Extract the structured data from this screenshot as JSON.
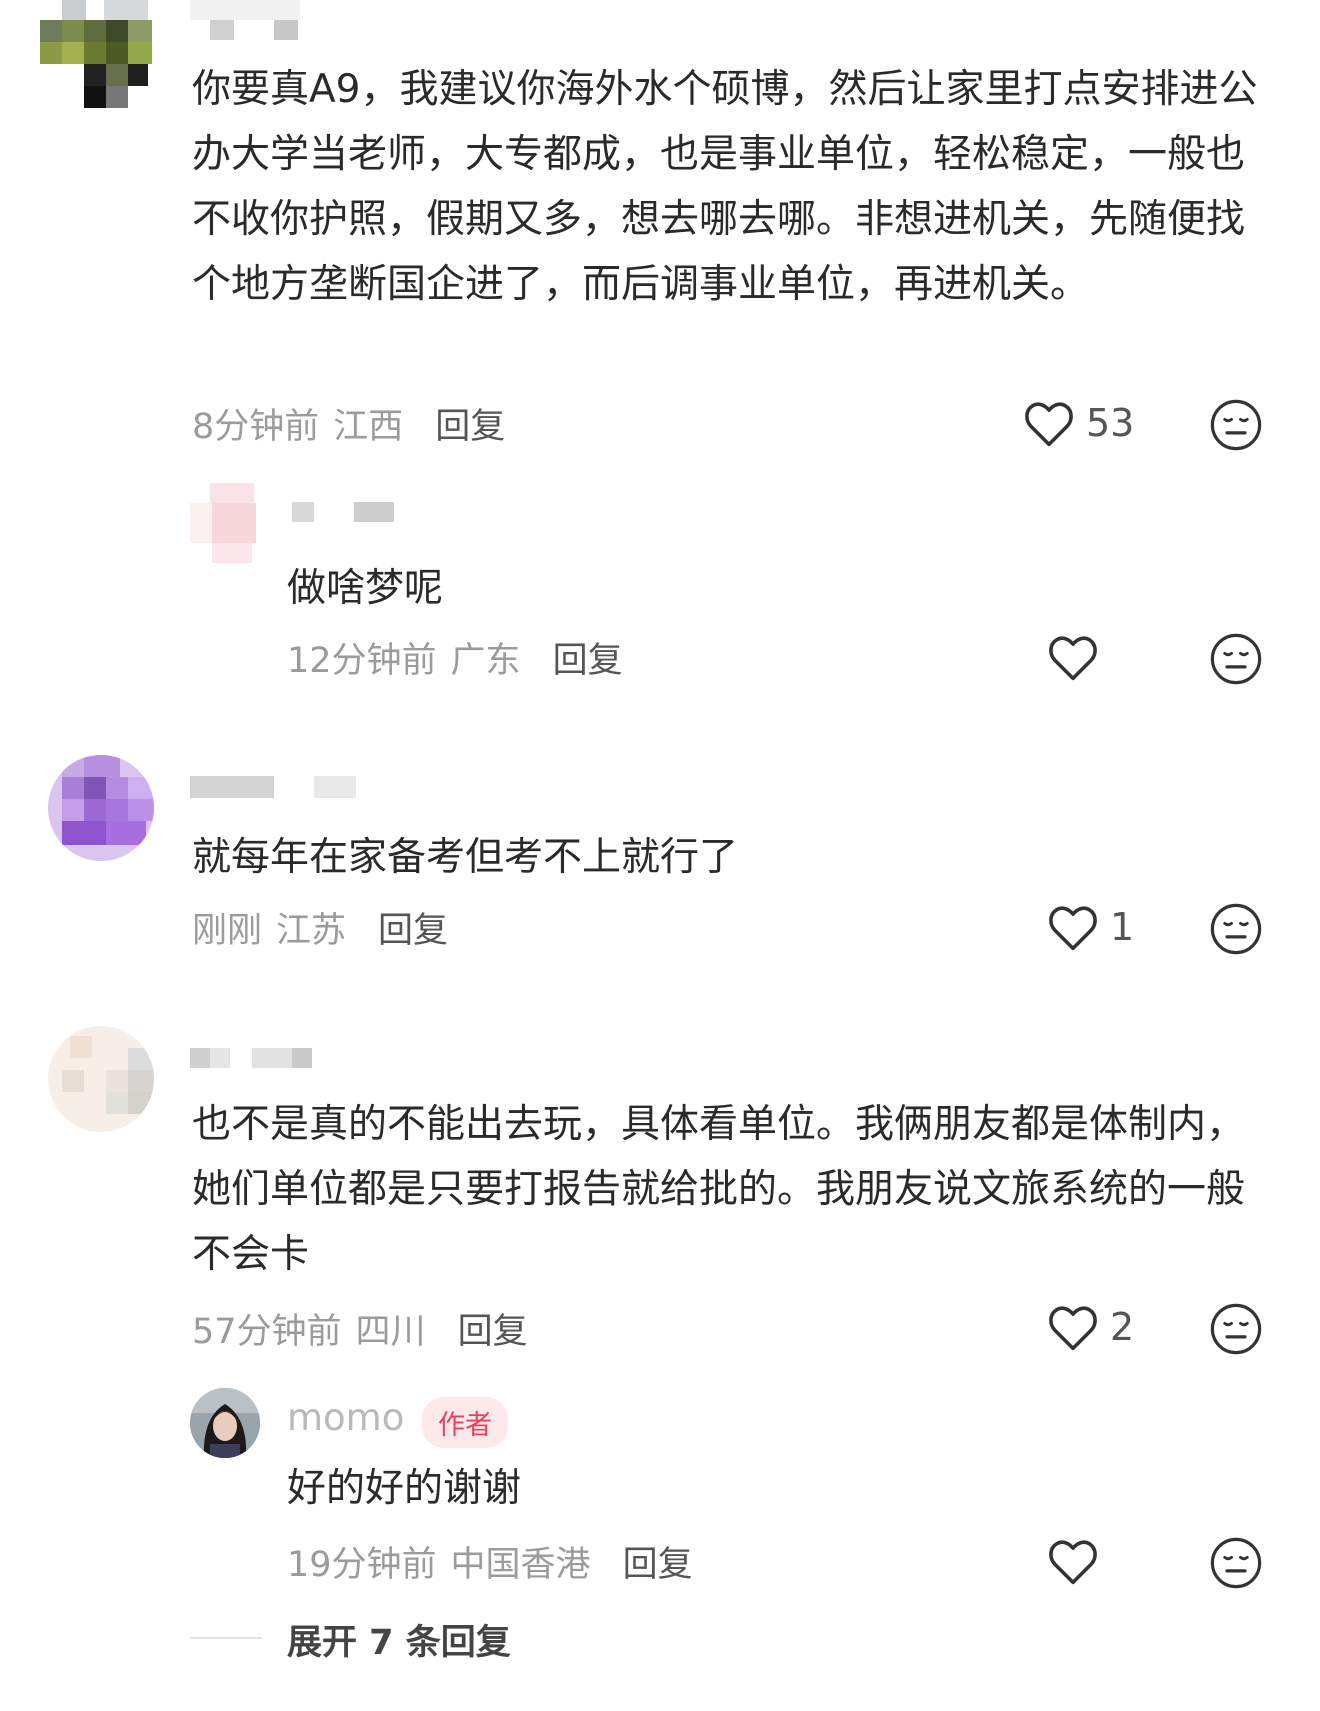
{
  "comments": [
    {
      "content": "你要真A9，我建议你海外水个硕博，然后让家里打点安排进公办大学当老师，大专都成，也是事业单位，轻松稳定，一般也不收你护照，假期又多，想去哪去哪。非想进机关，先随便找个地方垄断国企进了，而后调事业单位，再进机关。",
      "time": "8分钟前",
      "location": "江西",
      "reply_label": "回复",
      "likes": "53"
    },
    {
      "content": "做啥梦呢",
      "time": "12分钟前",
      "location": "广东",
      "reply_label": "回复",
      "likes": ""
    },
    {
      "content": "就每年在家备考但考不上就行了",
      "time": "刚刚",
      "location": "江苏",
      "reply_label": "回复",
      "likes": "1"
    },
    {
      "content": "也不是真的不能出去玩，具体看单位。我俩朋友都是体制内，她们单位都是只要打报告就给批的。我朋友说文旅系统的一般不会卡",
      "time": "57分钟前",
      "location": "四川",
      "reply_label": "回复",
      "likes": "2"
    },
    {
      "username": "momo",
      "badge": "作者",
      "content": "好的好的谢谢",
      "time": "19分钟前",
      "location": "中国香港",
      "reply_label": "回复",
      "likes": ""
    }
  ],
  "expand_label": "展开 7 条回复",
  "icons": {
    "like": "heart-outline-icon",
    "dislike": "meh-face-icon"
  },
  "colors": {
    "badge_text": "#e8425a",
    "badge_bg": "#fde8ec",
    "meta_text": "#9b9b9b",
    "body_text": "#2a2a2a"
  }
}
